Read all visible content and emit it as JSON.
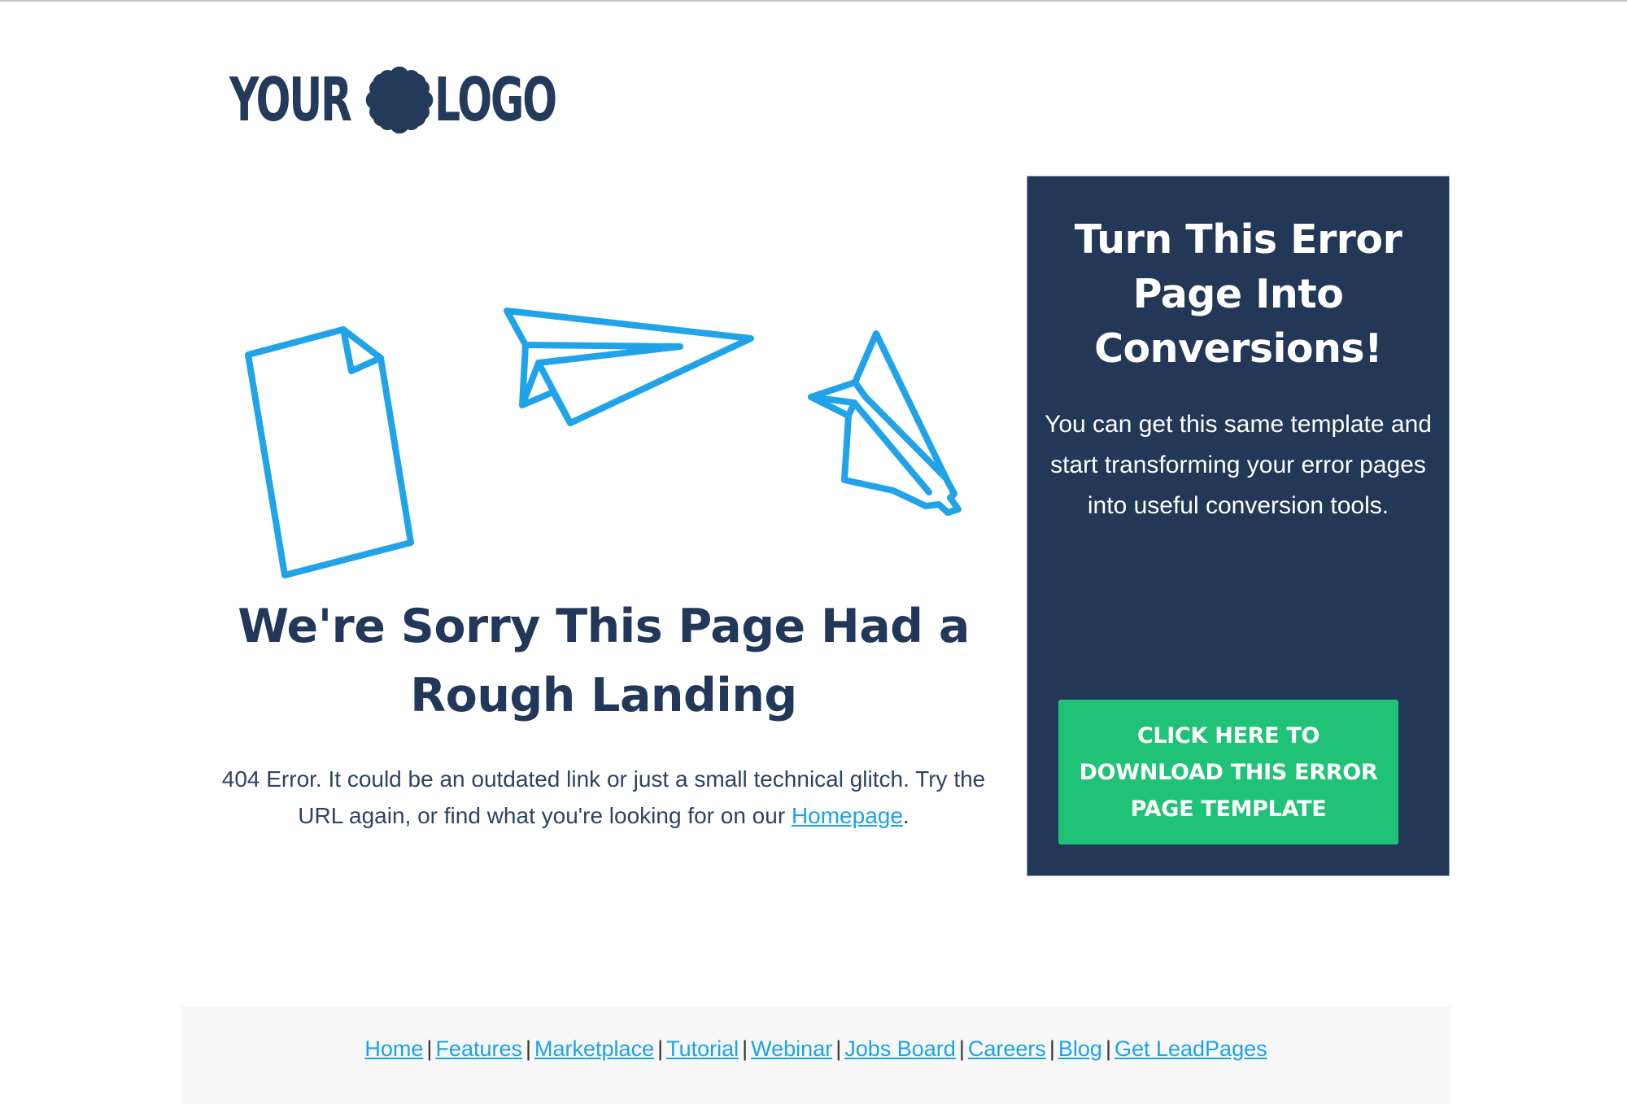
{
  "logo": {
    "left_word": "YOUR",
    "right_word": "LOGO",
    "mark_icon": "scalloped-badge-icon",
    "color": "#243a5a"
  },
  "illustration": {
    "icons": [
      "document-icon",
      "paper-plane-icon",
      "crashed-paper-plane-icon"
    ],
    "stroke_color": "#21a3ea"
  },
  "main": {
    "heading": "We're Sorry This Page Had a Rough Landing",
    "message_before_link": "404 Error. It could be an outdated link or just a small technical glitch. Try the URL again, or find what you're looking for on our ",
    "homepage_link": "Homepage",
    "message_after_link": "."
  },
  "cta": {
    "title": "Turn This Error Page Into Conversions!",
    "body": "You can get this same template and start transforming your error pages into useful conversion tools.",
    "button_label": "Click Here To Download This Error Page Template",
    "panel_color": "#223856",
    "button_color": "#1fc277"
  },
  "footer": {
    "separator": "|",
    "links": [
      {
        "label": "Home"
      },
      {
        "label": "Features"
      },
      {
        "label": "Marketplace"
      },
      {
        "label": "Tutorial"
      },
      {
        "label": "Webinar"
      },
      {
        "label": "Jobs Board"
      },
      {
        "label": "Careers"
      },
      {
        "label": "Blog"
      },
      {
        "label": "Get LeadPages"
      }
    ]
  }
}
